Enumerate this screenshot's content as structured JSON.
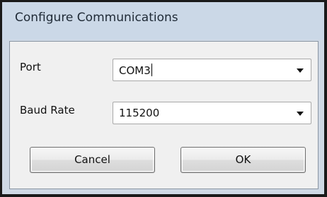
{
  "window": {
    "title": "Configure Communications"
  },
  "form": {
    "port": {
      "label": "Port",
      "value": "COM3"
    },
    "baud_rate": {
      "label": "Baud Rate",
      "value": "115200"
    }
  },
  "buttons": {
    "cancel_label": "Cancel",
    "ok_label": "OK"
  },
  "icons": {
    "dropdown": "chevron-down-icon"
  }
}
